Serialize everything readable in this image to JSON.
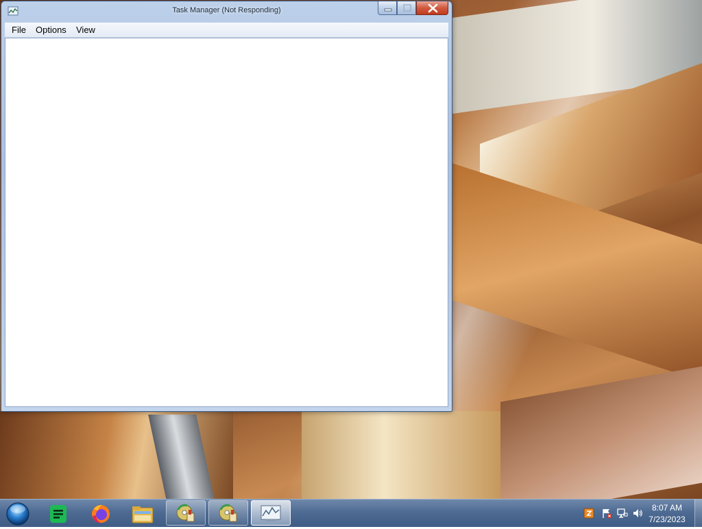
{
  "window": {
    "title": "Task Manager (Not Responding)",
    "menu": [
      "File",
      "Options",
      "View"
    ]
  },
  "taskbar": {
    "pinned": [
      {
        "name": "start-orb",
        "icon": "windows-orb-icon"
      },
      {
        "name": "docs-app",
        "icon": "green-document-icon"
      },
      {
        "name": "firefox",
        "icon": "firefox-icon"
      },
      {
        "name": "file-explorer",
        "icon": "folder-icon"
      },
      {
        "name": "installer-1",
        "icon": "installer-cd-icon"
      },
      {
        "name": "installer-2",
        "icon": "installer-cd-icon"
      },
      {
        "name": "task-manager",
        "icon": "task-manager-icon",
        "active": true
      }
    ],
    "tray": {
      "icons": [
        "java-update-icon",
        "action-center-flag-icon",
        "network-icon",
        "volume-icon"
      ],
      "time": "8:07 AM",
      "date": "7/23/2023"
    }
  },
  "colors": {
    "taskbar": "#4e6b93",
    "window_frame": "#a9c0e0",
    "close_button": "#c13a1e"
  }
}
